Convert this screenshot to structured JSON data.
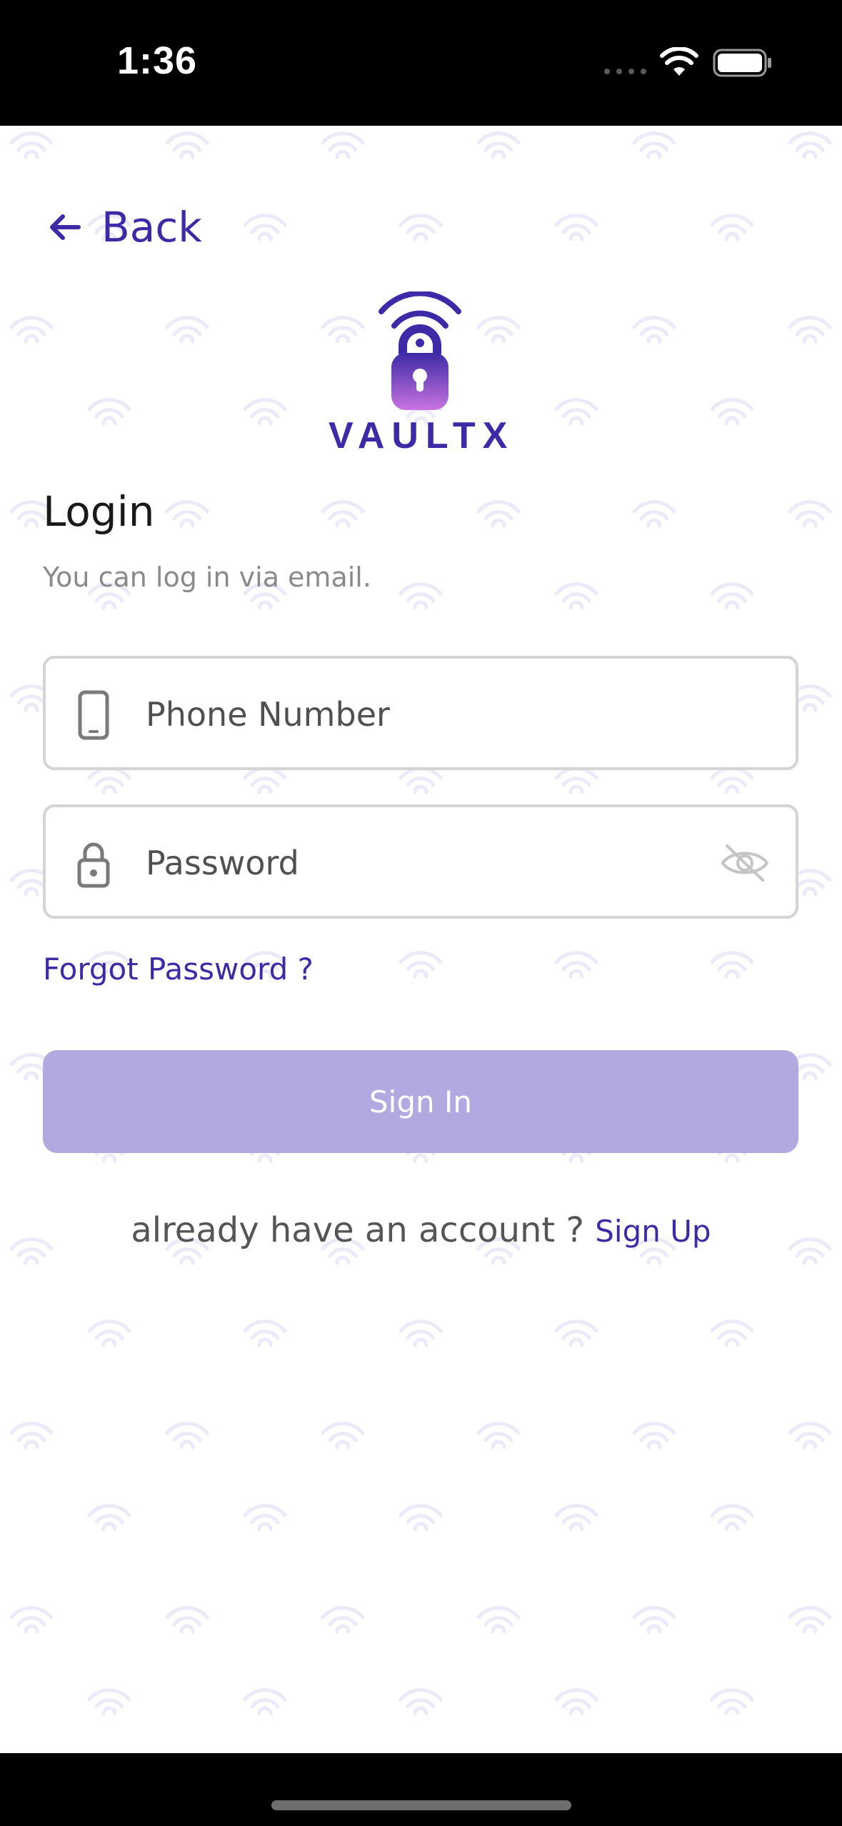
{
  "status_bar": {
    "time": "1:36"
  },
  "nav": {
    "back_label": "Back"
  },
  "brand": {
    "name": "VAULTX",
    "accent_color": "#3d2aa6",
    "gradient_colors": [
      "#3d2aa6",
      "#c874e0"
    ]
  },
  "login": {
    "title": "Login",
    "subtitle": "You can log in via email."
  },
  "fields": {
    "phone_placeholder": "Phone Number",
    "phone_icon": "smartphone-icon",
    "password_placeholder": "Password",
    "password_icon": "lock-icon",
    "password_toggle_icon": "eye-off-icon"
  },
  "links": {
    "forgot_password": "Forgot Password ?"
  },
  "actions": {
    "sign_in": "Sign In",
    "sign_in_color": "#b1a9e0"
  },
  "footer": {
    "prompt": "already have an account ?",
    "sign_up": "Sign Up"
  }
}
